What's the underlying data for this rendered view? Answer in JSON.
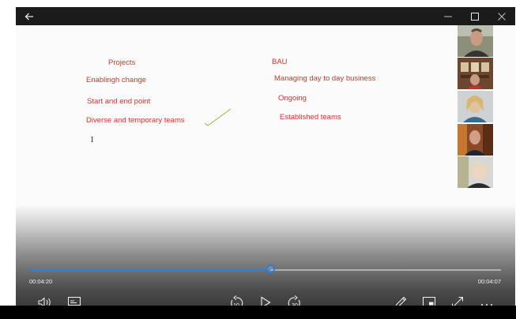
{
  "window": {
    "back_icon": "arrow-left-icon",
    "controls": [
      "minimize-icon",
      "maximize-icon",
      "close-icon"
    ]
  },
  "slide": {
    "left_column": {
      "heading": "Projects",
      "items": [
        "Enablingh change",
        "Start and end point",
        "Diverse and temporary teams"
      ]
    },
    "right_column": {
      "heading": "BAU",
      "items": [
        "Managing day to day business",
        "Ongoing",
        "Established teams"
      ]
    },
    "cursor_text": "I",
    "ink_color": "#d4322c",
    "check_color": "#8dbb35"
  },
  "participants": [
    {
      "name_icon": "participant-video-1"
    },
    {
      "name_icon": "participant-video-2"
    },
    {
      "name_icon": "participant-video-3"
    },
    {
      "name_icon": "participant-video-4"
    },
    {
      "name_icon": "participant-video-5"
    }
  ],
  "player": {
    "elapsed": "00:04:20",
    "remaining": "00:04:07",
    "progress": 0.513,
    "accent": "#2f7fd3",
    "skip_back_label": "10",
    "skip_forward_label": "30"
  }
}
